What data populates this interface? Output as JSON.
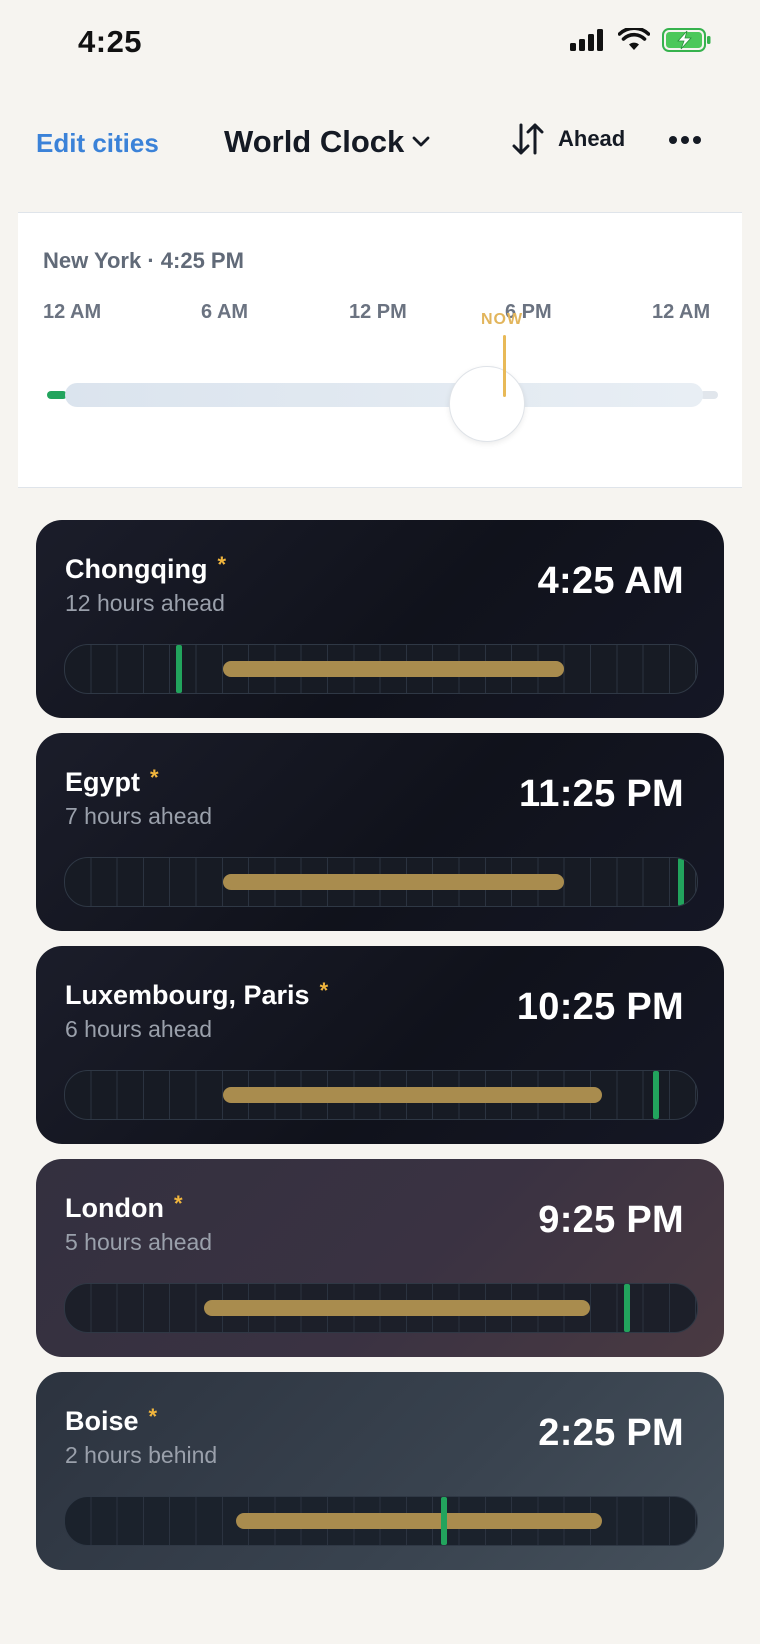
{
  "status_bar": {
    "time": "4:25"
  },
  "nav": {
    "edit_label": "Edit cities",
    "title": "World Clock",
    "sort_label": "Ahead"
  },
  "reference": {
    "title": "New York · 4:25 PM",
    "ticks": [
      "12 AM",
      "6 AM",
      "12 PM",
      "6 PM",
      "12 AM"
    ],
    "now_label": "NOW",
    "now_fraction": 0.684
  },
  "cities": [
    {
      "name": "Chongqing",
      "star": "*",
      "diff": "12 hours ahead",
      "time": "4:25 AM",
      "day_start": 0.25,
      "day_end": 0.79,
      "now": 0.18
    },
    {
      "name": "Egypt",
      "star": "*",
      "diff": "7 hours ahead",
      "time": "11:25 PM",
      "day_start": 0.25,
      "day_end": 0.79,
      "now": 0.975
    },
    {
      "name": "Luxembourg, Paris",
      "star": "*",
      "diff": "6 hours ahead",
      "time": "10:25 PM",
      "day_start": 0.25,
      "day_end": 0.85,
      "now": 0.935
    },
    {
      "name": "London",
      "star": "*",
      "diff": "5 hours ahead",
      "time": "9:25 PM",
      "day_start": 0.22,
      "day_end": 0.83,
      "now": 0.89
    },
    {
      "name": "Boise",
      "star": "*",
      "diff": "2 hours behind",
      "time": "2:25 PM",
      "day_start": 0.27,
      "day_end": 0.85,
      "now": 0.6
    }
  ],
  "colors": {
    "accent": "#3b82d8",
    "now_marker": "#22a45d",
    "daylight_bar": "#a98c4e",
    "star": "#f0b53d",
    "now_line": "#e8b957"
  }
}
